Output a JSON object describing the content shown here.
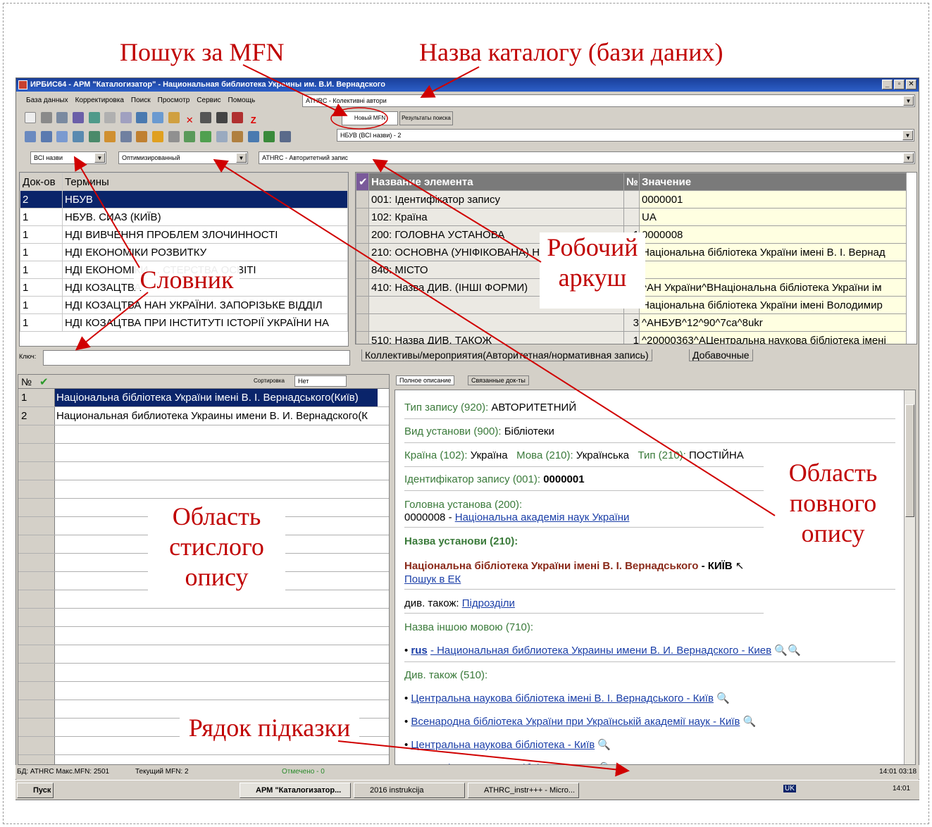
{
  "annotations": {
    "mfn_search": "Пошук за MFN",
    "catalog_name": "Назва каталогу (бази даних)",
    "dictionary": "Словник",
    "worksheet_l1": "Робочий",
    "worksheet_l2": "аркуш",
    "brief_l1": "Область",
    "brief_l2": "стислого",
    "brief_l3": "опису",
    "full_l1": "Область",
    "full_l2": "повного",
    "full_l3": "опису",
    "hint_line": "Рядок підказки"
  },
  "window": {
    "title": "ИРБИС64 - АРМ \"Каталогизатор\" - Национальная библиотека Украины им. В.И. Вернадского",
    "menu": [
      "База данных",
      "Корректировка",
      "Поиск",
      "Просмотр",
      "Сервис",
      "Помощь"
    ],
    "db_combo": "ATHRC - Колективні автори",
    "tab_new_mfn": "Новый MFN",
    "tab_results": "Результаты поиска",
    "search_combo": "НБУВ (ВСІ назви) - 2",
    "filter_combo": "ВСІ назви",
    "mode_combo": "Оптимизированный",
    "worksheet_combo": "ATHRC - Авторитетний запис"
  },
  "dictionary": {
    "headers": [
      "Док-ов",
      "Термины"
    ],
    "rows": [
      {
        "count": "2",
        "term": "НБУВ"
      },
      {
        "count": "1",
        "term": "НБУВ. СИАЗ (КИЇВ)"
      },
      {
        "count": "1",
        "term": "НДІ ВИВЧЕННЯ ПРОБЛЕМ ЗЛОЧИННОСТІ"
      },
      {
        "count": "1",
        "term": "НДІ ЕКОНОМІКИ РОЗВИТКУ"
      },
      {
        "count": "1",
        "term": "НДІ ЕКОНОМІКИ ... СТЕРСТВА ОСВІТІ"
      },
      {
        "count": "1",
        "term": "НДІ КОЗАЦТВА"
      },
      {
        "count": "1",
        "term": "НДІ КОЗАЦТВА НАН УКРАЇНИ. ЗАПОРІЗЬКЕ ВІДДІЛ"
      },
      {
        "count": "1",
        "term": "НДІ КОЗАЦТВА ПРИ ІНСТИТУТІ ІСТОРІЇ УКРАЇНИ НА"
      }
    ],
    "key_label": "Ключ:"
  },
  "worksheet": {
    "headers": [
      "Название элемента",
      "№",
      "Значение"
    ],
    "rows": [
      {
        "name": "001: Ідентифікатор запису",
        "n": "",
        "value": "0000001"
      },
      {
        "name": "102: Країна",
        "n": "",
        "value": "UA"
      },
      {
        "name": "200: ГОЛОВНА УСТАНОВА",
        "n": "1",
        "value": "0000008"
      },
      {
        "name": "210: ОСНОВНА (УНІФІКОВАНА) Н",
        "n": "",
        "value": "Національна бібліотека України імені В. І. Вернад"
      },
      {
        "name": "840: МІСТО",
        "n": "",
        "value": ""
      },
      {
        "name": "410: Назва ДИВ. (ІНШІ ФОРМИ)",
        "n": "",
        "value": "^АН України^ВНаціональна бібліотека України ім"
      },
      {
        "name": "",
        "n": "",
        "value": "Національна бібліотека України імені Володимир"
      },
      {
        "name": "",
        "n": "3",
        "value": "^АНБУВ^12^90^7ca^8ukr"
      },
      {
        "name": "510: Назва ДИВ. ТАКОЖ",
        "n": "1",
        "value": "^20000363^АЦентральна наукова бібліотека імені"
      }
    ],
    "tab1": "Коллективы/мероприятия(Авторитетная/нормативная запись)",
    "tab2": "Добавочные"
  },
  "brief": {
    "headers": [
      "№",
      "✔"
    ],
    "sort_label": "Сортировка",
    "sort_value": "Нет",
    "rows": [
      {
        "n": "1",
        "text": "Національна бібліотека України імені В. І. Вернадського(Київ)"
      },
      {
        "n": "2",
        "text": "Национальная библиотека Украины имени В. И. Вернадского(К"
      }
    ]
  },
  "full": {
    "tab1": "Полное описание",
    "tab2": "Связанные док-ты",
    "record_type_label": "Тип запису (920):",
    "record_type": "АВТОРИТЕТНИЙ",
    "inst_type_label": "Вид установи (900):",
    "inst_type": "Бібліотеки",
    "country_label": "Країна (102):",
    "country": "Україна",
    "lang_label": "Мова (210):",
    "lang": "Українська",
    "type_label": "Тип (210):",
    "type": "ПОСТІЙНА",
    "id_label": "Ідентифікатор запису (001):",
    "id": "0000001",
    "head_label": "Головна установа (200):",
    "head_code": "0000008 -",
    "head_link": "Національна академія наук України",
    "name_label": "Назва установи (210):",
    "name_value": "Національна бібліотека України імені В. І. Вернадського",
    "name_city": "- КИЇВ",
    "search_ek": "Пошук в ЕК",
    "see_also_label": "див. також:",
    "see_also_link": "Підрозділи",
    "other_lang_label": "Назва іншою мовою (710):",
    "other_lang_code": "rus",
    "other_lang_link": "- Национальная библиотека Украины имени В. И. Вернадского - Киев",
    "see_label": "Див. також (510):",
    "see": [
      "Центральна наукова бібліотека імені В. І. Вернадського - Київ",
      "Всенародна бібліотека України при Українській академії наук - Київ",
      "Центральна наукова бібліотека - Київ",
      "Академія наук УСРР. Бібліотека - Київ"
    ]
  },
  "statusbar": {
    "db": "БД: ATHRC Макс.MFN: 2501",
    "cur": "Текущий MFN: 2",
    "marked": "Отмечено - 0",
    "clock": "14:01 03:18"
  },
  "taskbar": {
    "start": "Пуск",
    "t1": "АРМ \"Каталогизатор...",
    "t2": "2016 instrukcija",
    "t3": "ATHRC_instr+++ - Micro...",
    "lang": "UK",
    "time": "14:01"
  },
  "colors": {
    "annotation": "#c00000",
    "selection": "#0a246a",
    "titlebar": "#2c5fc8",
    "arrow": "#d00000"
  }
}
